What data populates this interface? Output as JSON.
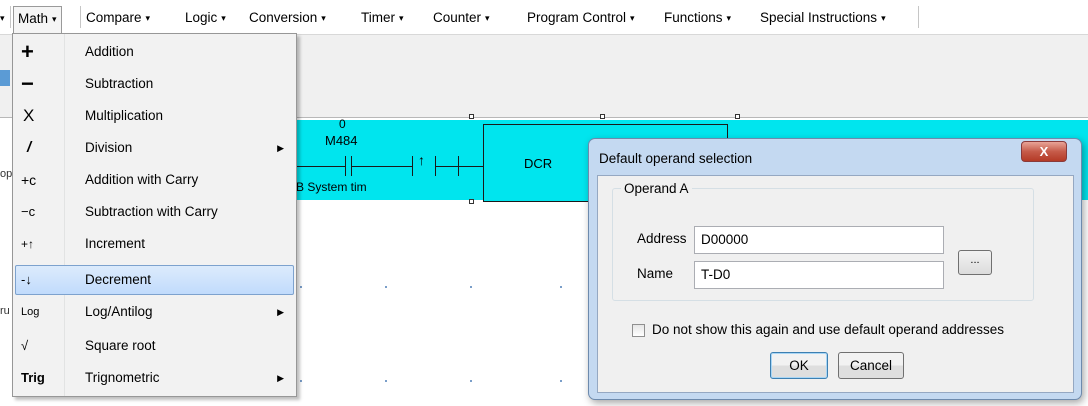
{
  "menubar": {
    "items": [
      {
        "label": "Math"
      },
      {
        "label": "Compare"
      },
      {
        "label": "Logic"
      },
      {
        "label": "Conversion"
      },
      {
        "label": "Timer"
      },
      {
        "label": "Counter"
      },
      {
        "label": "Program Control"
      },
      {
        "label": "Functions"
      },
      {
        "label": "Special Instructions"
      }
    ]
  },
  "ladder": {
    "contact_value": "0",
    "contact_name": "M484",
    "contact_desc": "B System tim",
    "instruction": "DCR"
  },
  "math_menu": {
    "items": [
      {
        "icon": "+",
        "icon_name": "plus-icon",
        "label": "Addition",
        "has_submenu": false
      },
      {
        "icon": "−",
        "icon_name": "minus-icon",
        "label": "Subtraction",
        "has_submenu": false
      },
      {
        "icon": "X",
        "icon_name": "multiply-icon",
        "label": "Multiplication",
        "has_submenu": false
      },
      {
        "icon": "/",
        "icon_name": "divide-icon",
        "label": "Division",
        "has_submenu": true
      },
      {
        "icon": "+c",
        "icon_name": "add-carry-icon",
        "label": "Addition with Carry",
        "has_submenu": false
      },
      {
        "icon": "−c",
        "icon_name": "subtract-carry-icon",
        "label": "Subtraction with Carry",
        "has_submenu": false
      },
      {
        "icon": "+↑",
        "icon_name": "increment-icon",
        "label": "Increment",
        "has_submenu": false
      },
      {
        "icon": "-↓",
        "icon_name": "decrement-icon",
        "label": "Decrement",
        "has_submenu": false,
        "selected": true
      },
      {
        "icon": "Log",
        "icon_name": "log-icon",
        "label": "Log/Antilog",
        "has_submenu": true
      },
      {
        "icon": "√",
        "icon_name": "square-root-icon",
        "label": "Square root",
        "has_submenu": false
      },
      {
        "icon": "Trig",
        "icon_name": "trig-icon",
        "label": "Trignometric",
        "has_submenu": true
      }
    ]
  },
  "dialog": {
    "title": "Default operand selection",
    "close_label": "X",
    "group_label": "Operand A",
    "address_label": "Address",
    "address_value": "D00000",
    "name_label": "Name",
    "name_value": "T-D0",
    "browse_label": "...",
    "checkbox_label": "Do not show this again and use default operand addresses",
    "ok_label": "OK",
    "cancel_label": "Cancel"
  },
  "colors": {
    "ladder_bg": "#00e5ee",
    "selection": "#c1dbfc",
    "dialog_frame": "#c4d9f1"
  }
}
